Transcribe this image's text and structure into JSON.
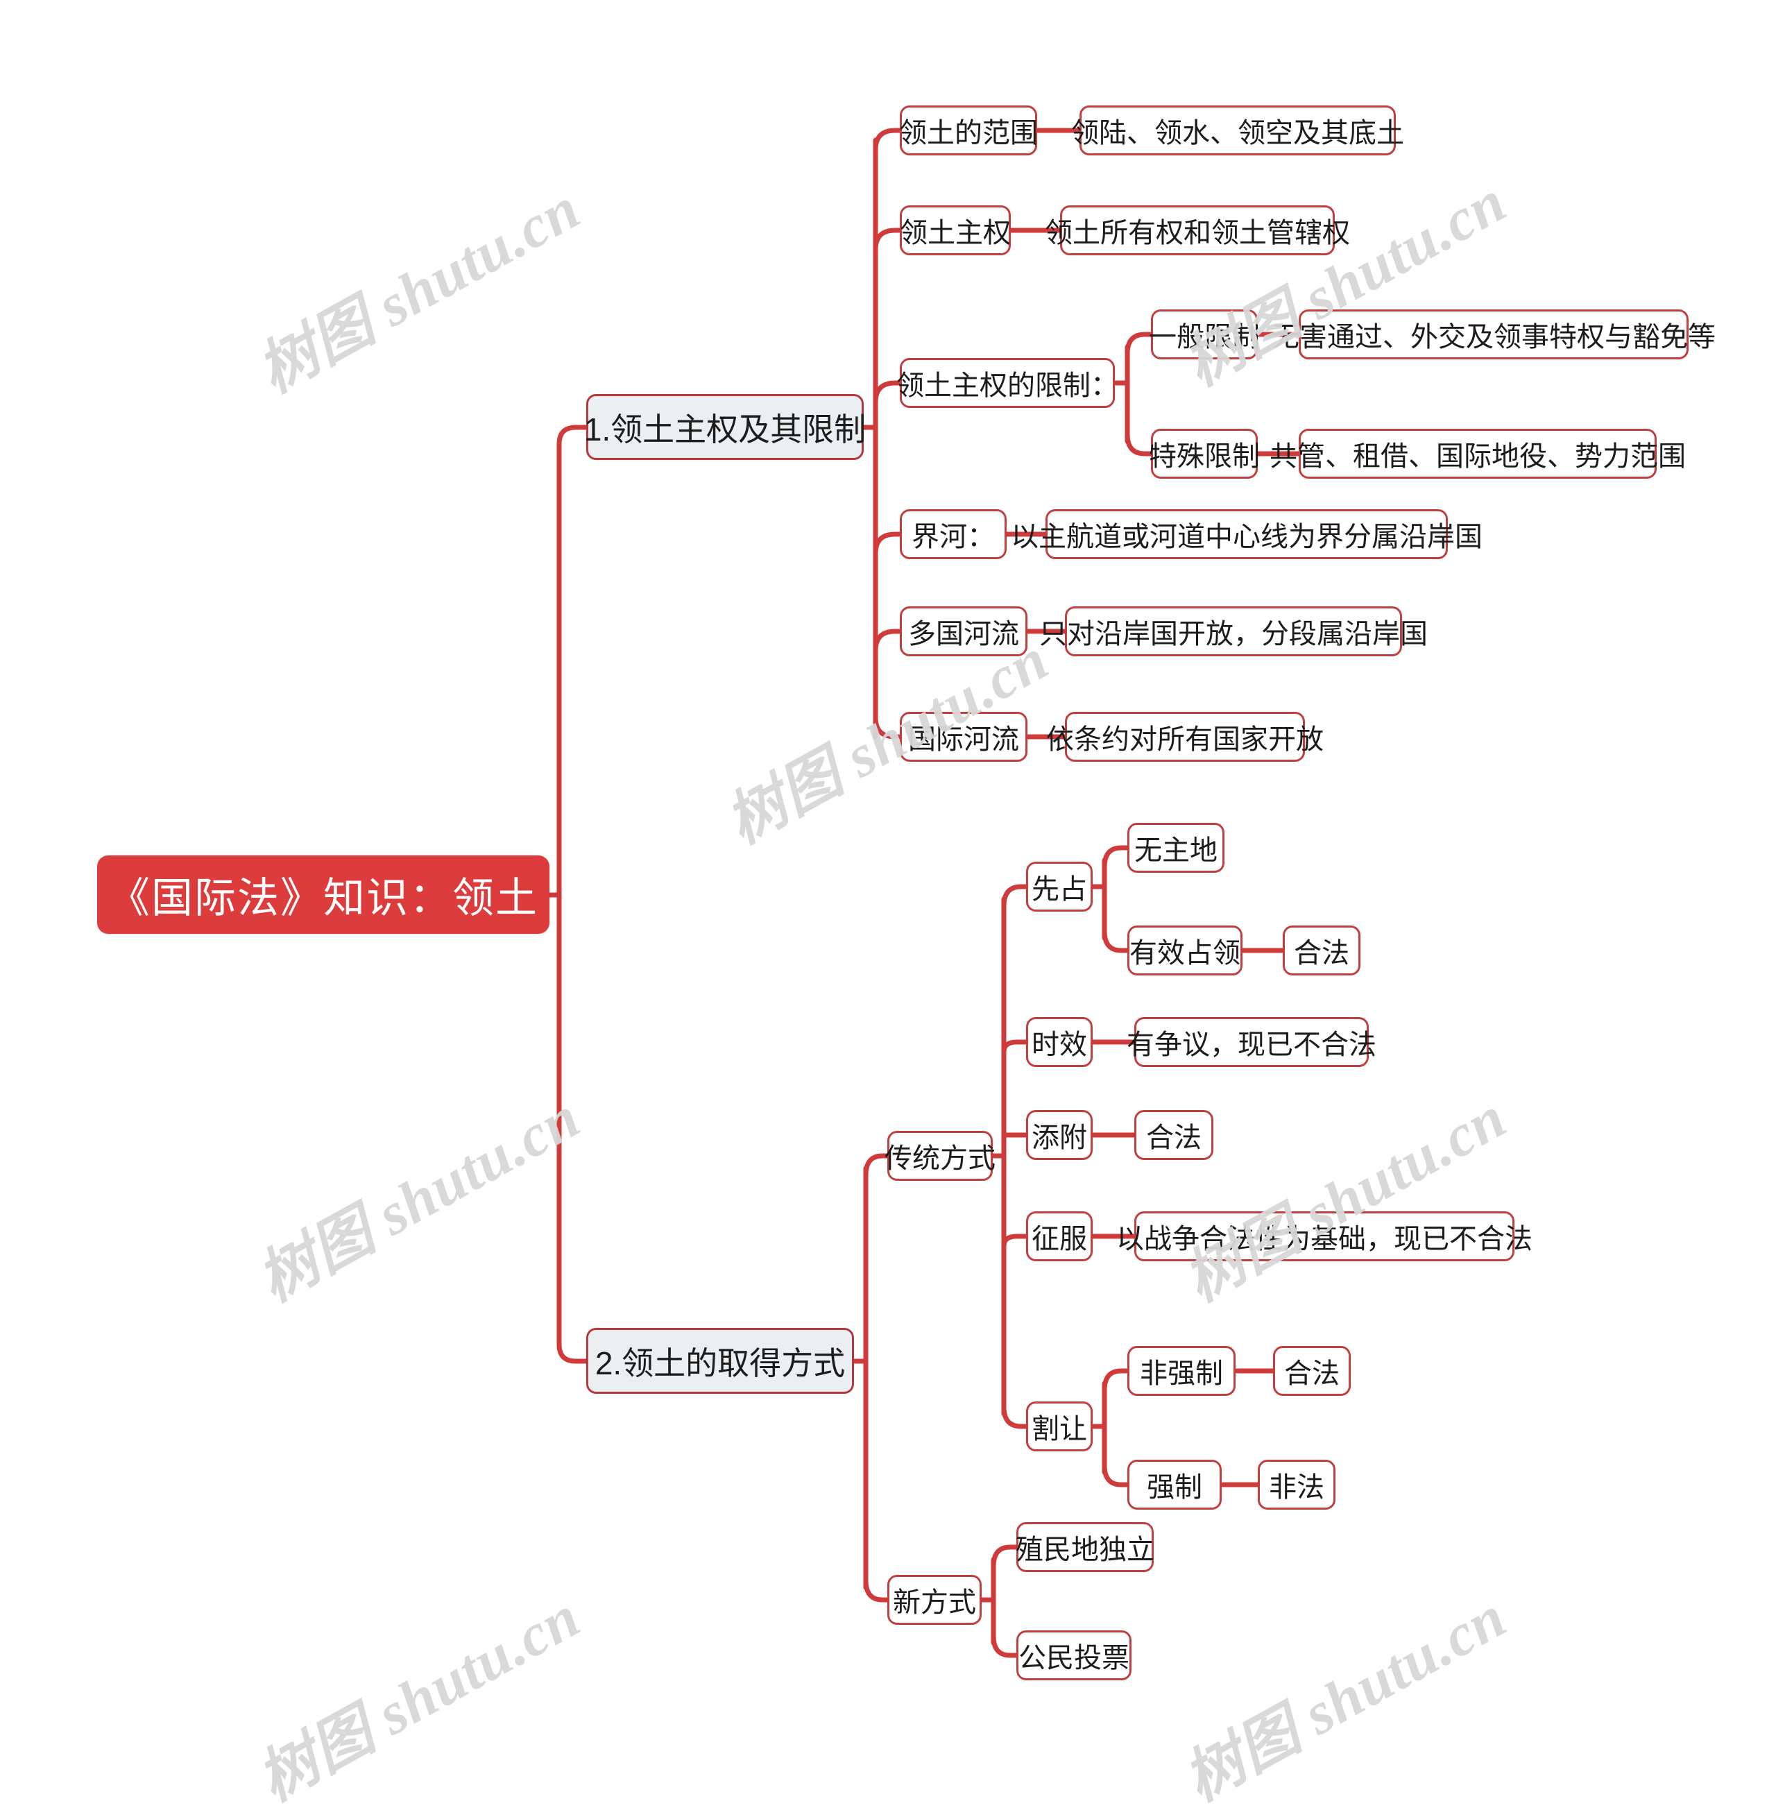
{
  "watermark": {
    "text": "树图 shutu.cn",
    "color": "#d7d7d7"
  },
  "theme": {
    "root_fill": "#dc3c3c",
    "root_text": "#ffffff",
    "level1_fill": "#eceff1",
    "node_fill": "#ffffff",
    "border": "#c0403f",
    "line": "#cf3a3a",
    "text": "#1c1c1c"
  },
  "mindmap": {
    "root": "《国际法》知识：领土",
    "branches": [
      {
        "label": "1.领土主权及其限制",
        "children": [
          {
            "label": "领土的范围",
            "children": [
              {
                "label": "领陆、领水、领空及其底土"
              }
            ]
          },
          {
            "label": "领土主权",
            "children": [
              {
                "label": "领土所有权和领土管辖权"
              }
            ]
          },
          {
            "label": "领土主权的限制：",
            "children": [
              {
                "label": "一般限制",
                "children": [
                  {
                    "label": "无害通过、外交及领事特权与豁免等"
                  }
                ]
              },
              {
                "label": "特殊限制",
                "children": [
                  {
                    "label": "共管、租借、国际地役、势力范围"
                  }
                ]
              }
            ]
          },
          {
            "label": "界河：",
            "children": [
              {
                "label": "以主航道或河道中心线为界分属沿岸国"
              }
            ]
          },
          {
            "label": "多国河流",
            "children": [
              {
                "label": "只对沿岸国开放，分段属沿岸国"
              }
            ]
          },
          {
            "label": "国际河流",
            "children": [
              {
                "label": "依条约对所有国家开放"
              }
            ]
          }
        ]
      },
      {
        "label": "2.领土的取得方式",
        "children": [
          {
            "label": "传统方式",
            "children": [
              {
                "label": "先占",
                "children": [
                  {
                    "label": "无主地"
                  },
                  {
                    "label": "有效占领",
                    "children": [
                      {
                        "label": "合法"
                      }
                    ]
                  }
                ]
              },
              {
                "label": "时效",
                "children": [
                  {
                    "label": "有争议，现已不合法"
                  }
                ]
              },
              {
                "label": "添附",
                "children": [
                  {
                    "label": "合法"
                  }
                ]
              },
              {
                "label": "征服",
                "children": [
                  {
                    "label": "以战争合法性为基础，现已不合法"
                  }
                ]
              },
              {
                "label": "割让",
                "children": [
                  {
                    "label": "非强制",
                    "children": [
                      {
                        "label": "合法"
                      }
                    ]
                  },
                  {
                    "label": "强制",
                    "children": [
                      {
                        "label": "非法"
                      }
                    ]
                  }
                ]
              }
            ]
          },
          {
            "label": "新方式",
            "children": [
              {
                "label": "殖民地独立"
              },
              {
                "label": "公民投票"
              }
            ]
          }
        ]
      }
    ]
  }
}
